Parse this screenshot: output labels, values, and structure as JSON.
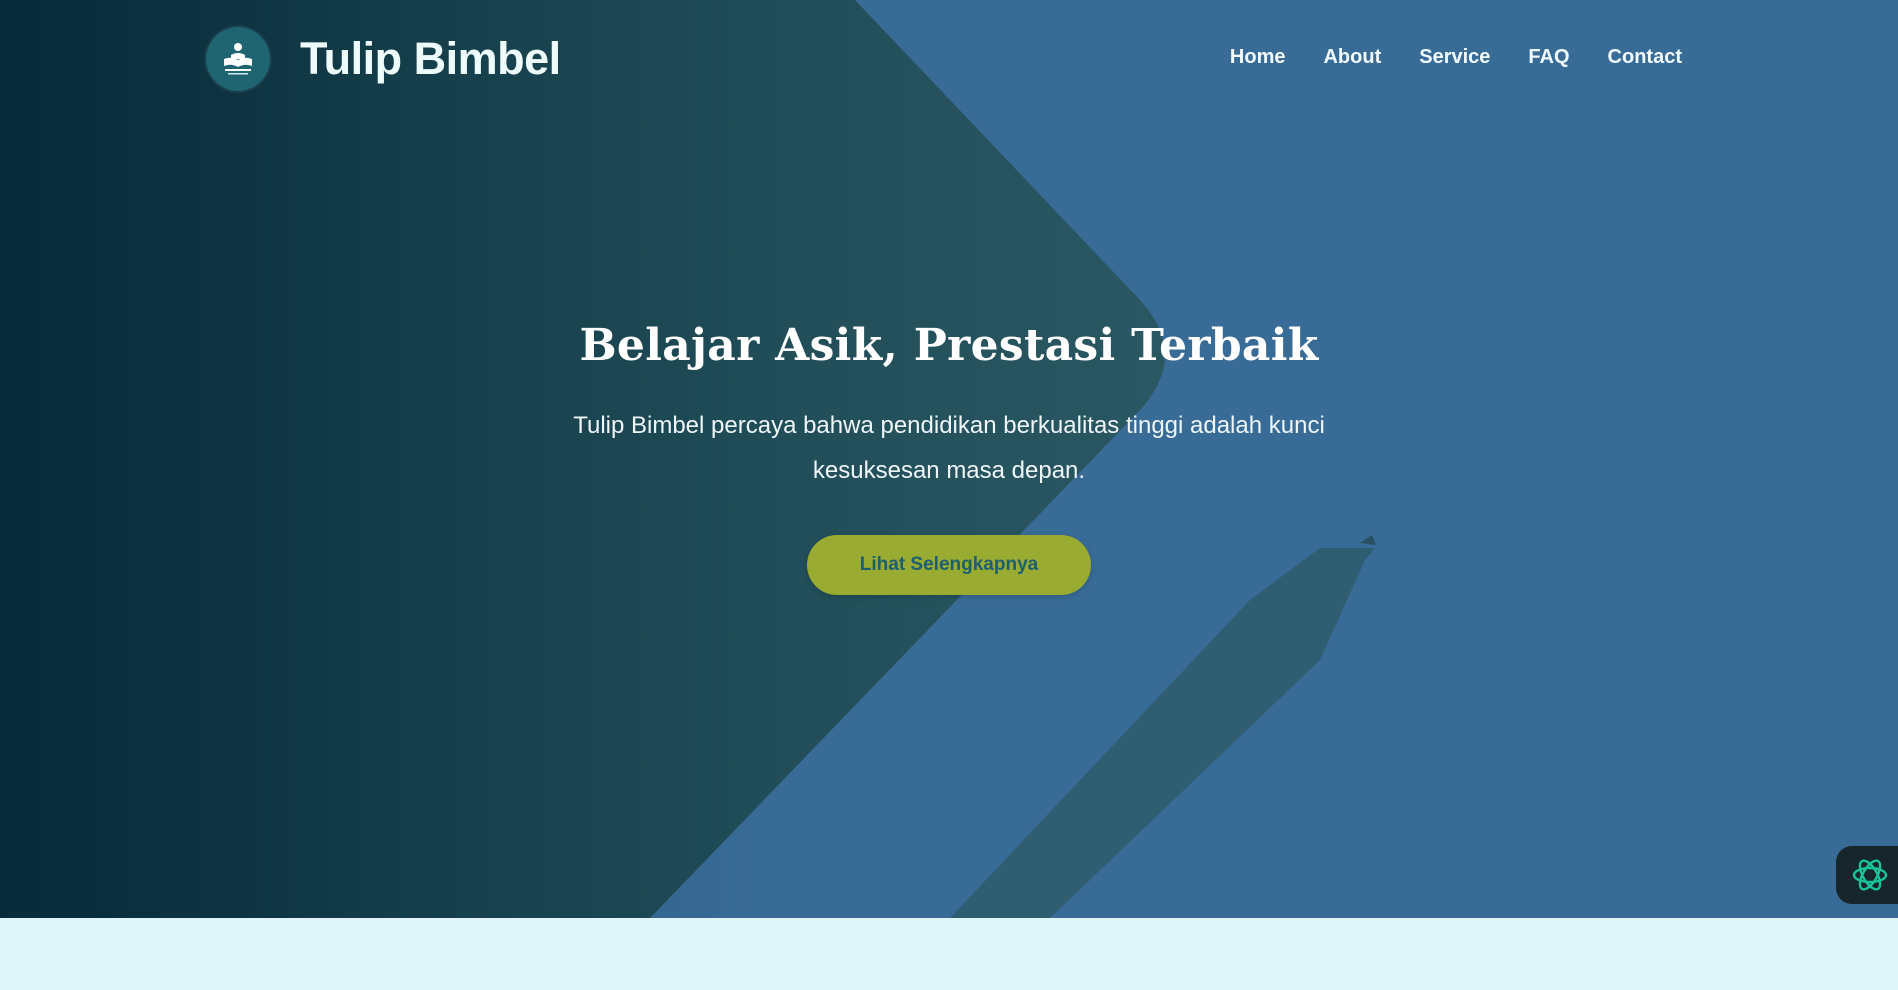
{
  "brand": {
    "name": "Tulip Bimbel",
    "logo_icon": "book-reader-logo"
  },
  "nav": {
    "items": [
      {
        "label": "Home"
      },
      {
        "label": "About"
      },
      {
        "label": "Service"
      },
      {
        "label": "FAQ"
      },
      {
        "label": "Contact"
      }
    ]
  },
  "hero": {
    "title": "Belajar Asik, Prestasi Terbaik",
    "subtitle": "Tulip Bimbel percaya bahwa pendidikan berkualitas tinggi adalah kunci kesuksesan masa depan.",
    "cta_label": "Lihat Selengkapnya"
  },
  "widget": {
    "icon": "ai-assistant-icon"
  },
  "colors": {
    "hero_blue": "#386b96",
    "hero_dark_teal": "#0a2e3b",
    "cta": "#9aab31",
    "cta_text": "#1d5f6e",
    "page_bg": "#dff5f8"
  }
}
